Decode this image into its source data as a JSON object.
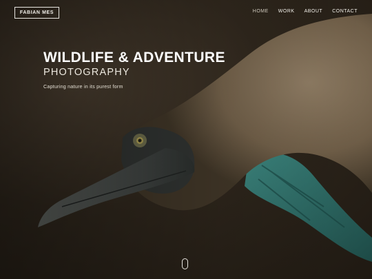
{
  "site": {
    "logo_text": "FABIAN MES"
  },
  "nav": {
    "items": [
      {
        "label": "HOME"
      },
      {
        "label": "WORK"
      },
      {
        "label": "ABOUT"
      },
      {
        "label": "CONTACT"
      }
    ]
  },
  "hero": {
    "title_line1": "WILDLIFE & ADVENTURE",
    "title_line2": "PHOTOGRAPHY",
    "tagline": "Capturing nature in its purest form",
    "background_subject": "blue-footed booby close-up"
  },
  "icons": {
    "scroll": "mouse-scroll-icon"
  },
  "colors": {
    "text": "#ffffff",
    "background": "#2a2218",
    "feet": "#2e6b66"
  }
}
